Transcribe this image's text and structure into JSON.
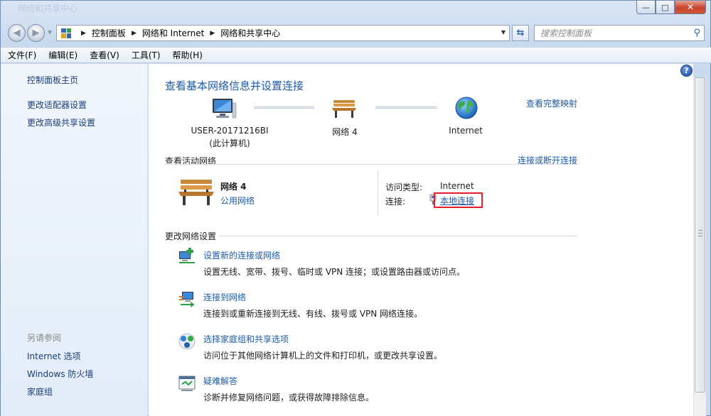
{
  "window": {
    "title_faded": "网络和共享中心",
    "controls": {
      "minimize": "—",
      "maximize": "□",
      "close": "✕"
    }
  },
  "nav": {
    "back": "◀",
    "forward": "▶",
    "breadcrumb": [
      "控制面板",
      "网络和 Internet",
      "网络和共享中心"
    ],
    "search_placeholder": "搜索控制面板"
  },
  "menu": [
    "文件(F)",
    "编辑(E)",
    "查看(V)",
    "工具(T)",
    "帮助(H)"
  ],
  "sidebar": {
    "items": [
      "控制面板主页",
      "更改适配器设置",
      "更改高级共享设置"
    ],
    "see_also_heading": "另请参阅",
    "see_also": [
      "Internet 选项",
      "Windows 防火墙",
      "家庭组"
    ]
  },
  "main": {
    "title": "查看基本网络信息并设置连接",
    "view_full_map": "查看完整映射",
    "map": {
      "computer_name": "USER-20171216BI",
      "computer_sub": "(此计算机)",
      "network": "网络  4",
      "internet": "Internet"
    },
    "active": {
      "heading": "查看活动网络",
      "connect_link": "连接或断开连接",
      "network_name": "网络  4",
      "network_type": "公用网络",
      "access_type_label": "访问类型:",
      "access_type_value": "Internet",
      "connection_label": "连接:",
      "connection_value": "本地连接"
    },
    "change": {
      "heading": "更改网络设置",
      "items": [
        {
          "title": "设置新的连接或网络",
          "desc": "设置无线、宽带、拨号、临时或 VPN 连接；或设置路由器或访问点。"
        },
        {
          "title": "连接到网络",
          "desc": "连接到或重新连接到无线、有线、拨号或 VPN 网络连接。"
        },
        {
          "title": "选择家庭组和共享选项",
          "desc": "访问位于其他网络计算机上的文件和打印机，或更改共享设置。"
        },
        {
          "title": "疑难解答",
          "desc": "诊断并修复网络问题，或获得故障排除信息。"
        }
      ]
    }
  },
  "colors": {
    "link": "#1e5aa8",
    "highlight": "#e0202a"
  }
}
